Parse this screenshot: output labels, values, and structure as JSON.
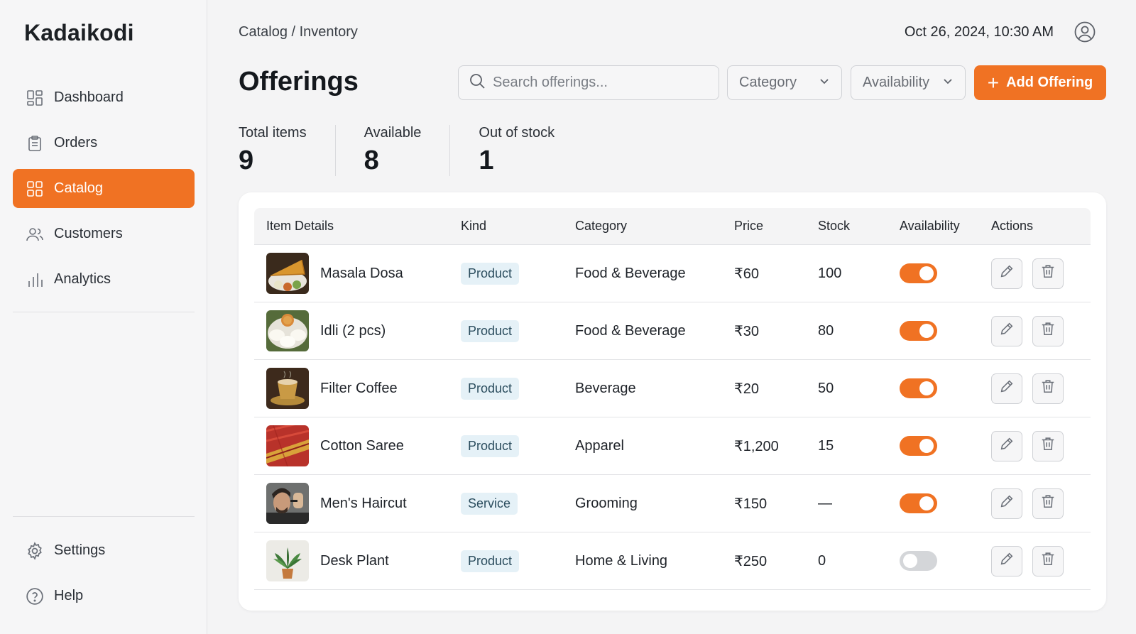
{
  "app": {
    "name": "Kadaikodi"
  },
  "sidebar": {
    "items": [
      {
        "label": "Dashboard",
        "icon": "dashboard-icon",
        "active": false
      },
      {
        "label": "Orders",
        "icon": "clipboard-icon",
        "active": false
      },
      {
        "label": "Catalog",
        "icon": "grid-icon",
        "active": true
      },
      {
        "label": "Customers",
        "icon": "users-icon",
        "active": false
      },
      {
        "label": "Analytics",
        "icon": "bar-chart-icon",
        "active": false
      }
    ],
    "bottom": [
      {
        "label": "Settings",
        "icon": "gear-icon"
      },
      {
        "label": "Help",
        "icon": "help-icon"
      }
    ]
  },
  "header": {
    "breadcrumb": "Catalog / Inventory",
    "datetime": "Oct 26, 2024, 10:30 AM",
    "title": "Offerings"
  },
  "toolbar": {
    "search_placeholder": "Search offerings...",
    "category_label": "Category",
    "availability_label": "Availability",
    "add_label": "Add Offering"
  },
  "stats": [
    {
      "label": "Total items",
      "value": "9"
    },
    {
      "label": "Available",
      "value": "8"
    },
    {
      "label": "Out of stock",
      "value": "1"
    }
  ],
  "table": {
    "columns": [
      "Item Details",
      "Kind",
      "Category",
      "Price",
      "Stock",
      "Availability",
      "Actions"
    ],
    "rows": [
      {
        "name": "Masala Dosa",
        "kind": "Product",
        "category": "Food & Beverage",
        "price": "₹60",
        "stock": "100",
        "available": true,
        "thumb": "dosa"
      },
      {
        "name": "Idli (2 pcs)",
        "kind": "Product",
        "category": "Food & Beverage",
        "price": "₹30",
        "stock": "80",
        "available": true,
        "thumb": "idli"
      },
      {
        "name": "Filter Coffee",
        "kind": "Product",
        "category": "Beverage",
        "price": "₹20",
        "stock": "50",
        "available": true,
        "thumb": "coffee"
      },
      {
        "name": "Cotton Saree",
        "kind": "Product",
        "category": "Apparel",
        "price": "₹1,200",
        "stock": "15",
        "available": true,
        "thumb": "saree"
      },
      {
        "name": "Men's Haircut",
        "kind": "Service",
        "category": "Grooming",
        "price": "₹150",
        "stock": "—",
        "available": true,
        "thumb": "haircut"
      },
      {
        "name": "Desk Plant",
        "kind": "Product",
        "category": "Home & Living",
        "price": "₹250",
        "stock": "0",
        "available": false,
        "thumb": "plant"
      }
    ]
  },
  "colors": {
    "accent": "#f07223",
    "badge_bg": "#e5f1f7",
    "toggle_off": "#d4d6d9"
  }
}
